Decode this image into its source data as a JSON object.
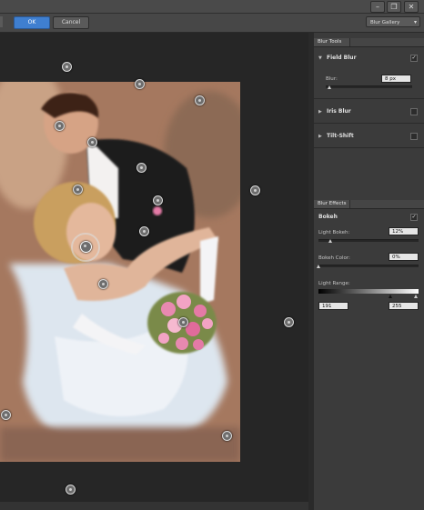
{
  "titlebar": {
    "minimize": "–",
    "restore": "❐",
    "close": "✕"
  },
  "options_bar": {
    "ok_label": "OK",
    "cancel_label": "Cancel",
    "gallery_select": "Blur Gallery"
  },
  "blur_tools": {
    "tab_label": "Blur Tools",
    "field_blur": {
      "label": "Field Blur",
      "enabled": true,
      "blur_label": "Blur:",
      "blur_value": "8 px",
      "blur_fraction": 0.05
    },
    "iris_blur": {
      "label": "Iris Blur",
      "enabled": false
    },
    "tilt_shift": {
      "label": "Tilt-Shift",
      "enabled": false
    }
  },
  "blur_effects": {
    "tab_label": "Blur Effects",
    "bokeh_label": "Bokeh",
    "bokeh_enabled": true,
    "light_bokeh": {
      "label": "Light Bokeh:",
      "value": "12%",
      "fraction": 0.12
    },
    "bokeh_color": {
      "label": "Bokeh Color:",
      "value": "0%",
      "fraction": 0.0
    },
    "light_range": {
      "label": "Light Range:",
      "low": "191",
      "high": "255"
    }
  },
  "icons": {
    "expanded": "triangle-down-icon",
    "collapsed": "triangle-right-icon",
    "pin": "blur-pin-icon"
  }
}
